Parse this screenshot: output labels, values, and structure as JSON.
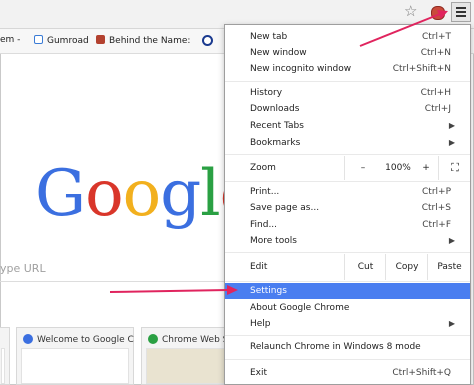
{
  "toolbar": {
    "star_icon": "star-icon",
    "menu_icon": "hamburger-menu-icon"
  },
  "bookmarks": [
    {
      "label": "em -",
      "icon_color": "#4a6fb5"
    },
    {
      "label": "Gumroad",
      "icon_color": "#3a7bd5"
    },
    {
      "label": "Behind the Name:",
      "icon_color": "#b3412f"
    },
    {
      "label": "",
      "icon_color": "#1a3a8f"
    }
  ],
  "page": {
    "logo": [
      "G",
      "o",
      "o",
      "g",
      "l",
      "e"
    ],
    "logo_colors": [
      "#3b6fe0",
      "#d9362a",
      "#f2b01e",
      "#3b6fe0",
      "#2aa043",
      "#d9362a"
    ],
    "search_hint": "ype URL"
  },
  "tiles": [
    {
      "title": "",
      "icon_color": "#cccccc"
    },
    {
      "title": "Welcome to Google C",
      "icon_color": "#3b6fe0"
    },
    {
      "title": "Chrome Web St",
      "icon_color": "#2aa043"
    }
  ],
  "menu": {
    "new_tab": {
      "label": "New tab",
      "shortcut": "Ctrl+T"
    },
    "new_window": {
      "label": "New window",
      "shortcut": "Ctrl+N"
    },
    "incognito": {
      "label": "New incognito window",
      "shortcut": "Ctrl+Shift+N"
    },
    "history": {
      "label": "History",
      "shortcut": "Ctrl+H"
    },
    "downloads": {
      "label": "Downloads",
      "shortcut": "Ctrl+J"
    },
    "recent_tabs": {
      "label": "Recent Tabs"
    },
    "bookmarks": {
      "label": "Bookmarks"
    },
    "zoom": {
      "label": "Zoom",
      "minus": "–",
      "value": "100%",
      "plus": "+",
      "fullscreen": "⛶"
    },
    "print": {
      "label": "Print...",
      "shortcut": "Ctrl+P"
    },
    "save_page": {
      "label": "Save page as...",
      "shortcut": "Ctrl+S"
    },
    "find": {
      "label": "Find...",
      "shortcut": "Ctrl+F"
    },
    "more_tools": {
      "label": "More tools"
    },
    "edit": {
      "label": "Edit",
      "cut": "Cut",
      "copy": "Copy",
      "paste": "Paste"
    },
    "settings": {
      "label": "Settings"
    },
    "about": {
      "label": "About Google Chrome"
    },
    "help": {
      "label": "Help"
    },
    "relaunch": {
      "label": "Relaunch Chrome in Windows 8 mode"
    },
    "exit": {
      "label": "Exit",
      "shortcut": "Ctrl+Shift+Q"
    }
  },
  "colors": {
    "highlight": "#4a7ef0",
    "annotation_arrow": "#e0245e"
  }
}
